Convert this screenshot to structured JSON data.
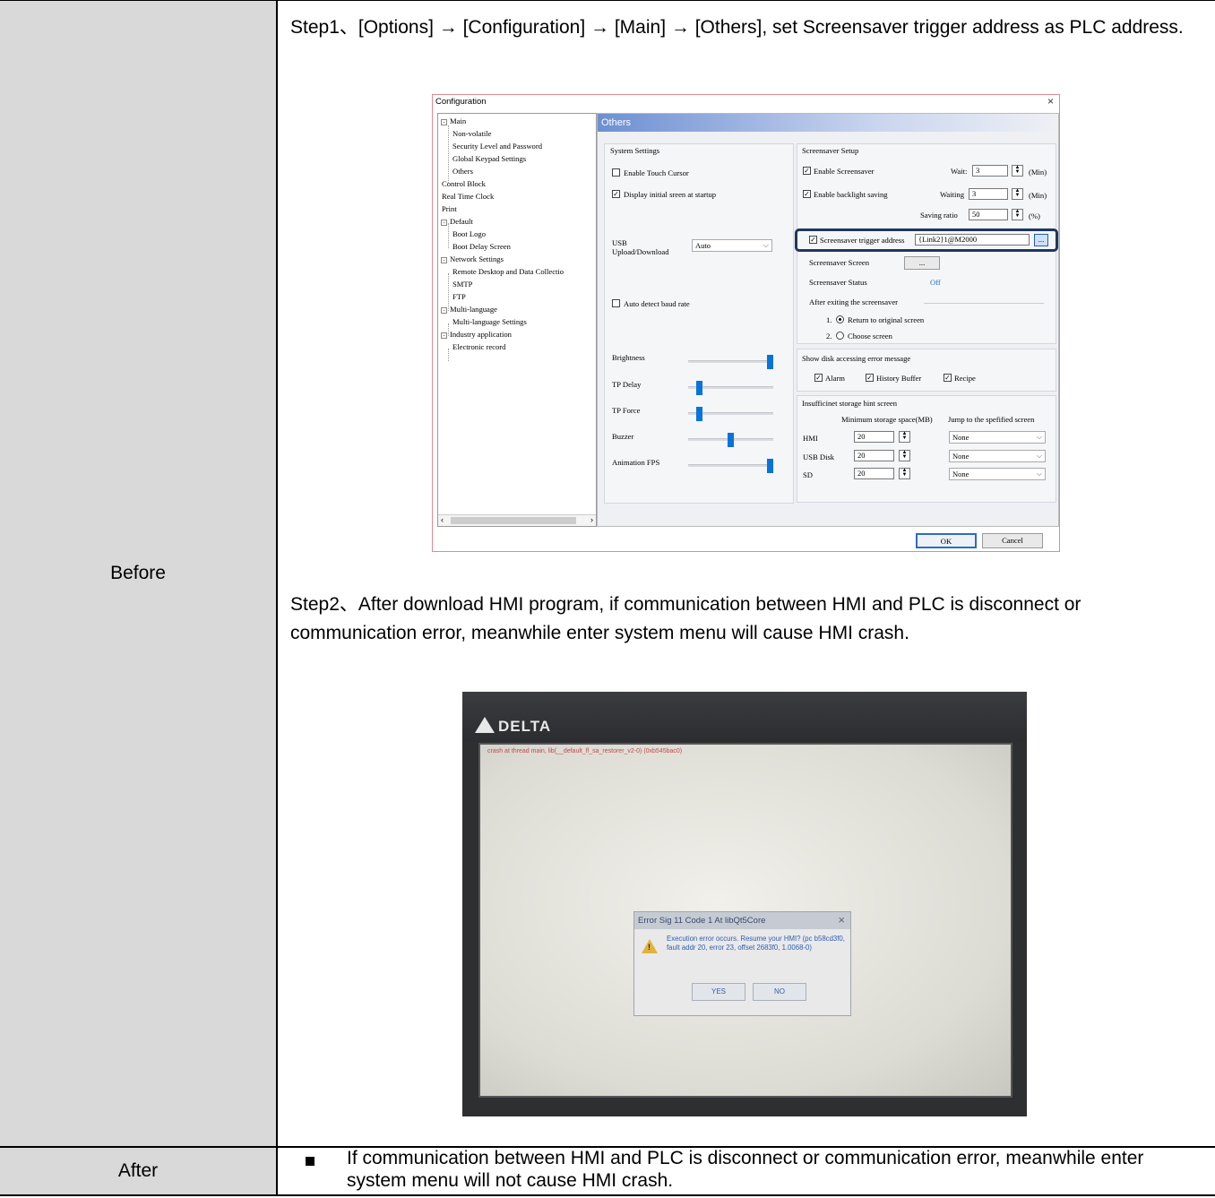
{
  "before": {
    "label": "Before",
    "step1": "Step1、[Options] → [Configuration] → [Main] → [Others], set Screensaver trigger address as PLC address.",
    "step2": "Step2、After download HMI program, if communication between HMI and PLC is disconnect or communication error, meanwhile enter system menu will cause HMI crash."
  },
  "after": {
    "label": "After",
    "text": "If communication between HMI and PLC is disconnect or communication error, meanwhile enter system menu will not cause HMI crash."
  },
  "dialog": {
    "title": "Configuration",
    "close": "×",
    "tree": [
      "Main",
      "Non-volatile",
      "Security Level and Password",
      "Global Keypad Settings",
      "Others",
      "Control Block",
      "Real Time Clock",
      "Print",
      "Default",
      "Boot Logo",
      "Boot Delay Screen",
      "Network Settings",
      "Remote Desktop and Data Collectio",
      "SMTP",
      "FTP",
      "Multi-language",
      "Multi-language Settings",
      "Industry application",
      "Electronic record"
    ],
    "panel_title": "Others",
    "system": {
      "title": "System Settings",
      "touch_cursor": "Enable Touch Cursor",
      "initial_screen": "Display initial sreen at startup",
      "usb_label_1": "USB",
      "usb_label_2": "Upload/Download",
      "usb_value": "Auto",
      "auto_baud": "Auto detect baud rate",
      "brightness": "Brightness",
      "tp_delay": "TP Delay",
      "tp_force": "TP Force",
      "buzzer": "Buzzer",
      "fps": "Animation FPS",
      "levels": {
        "brightness": 1.0,
        "tp_delay": 0.1,
        "tp_force": 0.1,
        "buzzer": 0.5,
        "fps": 1.0
      }
    },
    "screensaver": {
      "title": "Screensaver Setup",
      "enable": "Enable Screensaver",
      "wait_label": "Wait:",
      "wait_value": "3",
      "min1": "(Min)",
      "backlight": "Enable backlight saving",
      "waiting_label": "Waiting",
      "waiting_value": "3",
      "min2": "(Min)",
      "ratio_label": "Saving ratio",
      "ratio_value": "50",
      "pct": "(%)",
      "trigger": "Screensaver trigger address",
      "trigger_value": "{Link2}1@M2000",
      "browse": "...",
      "screen_label": "Screensaver Screen",
      "screen_btn": "...",
      "status_label": "Screensaver Status",
      "status_value": "Off",
      "exit_label": "After exiting the screensaver",
      "opt1": "1.",
      "opt1_text": "Return to original screen",
      "opt2": "2.",
      "opt2_text": "Choose screen"
    },
    "disk": {
      "title": "Show disk accessing error message",
      "alarm": "Alarm",
      "history": "History Buffer",
      "recipe": "Recipe"
    },
    "storage": {
      "title": "Insufficinet storage hint screen",
      "col1": "Minimum storage space(MB)",
      "col2": "Jump to the spefified screen",
      "rows": [
        {
          "name": "HMI",
          "value": "20",
          "screen": "None"
        },
        {
          "name": "USB Disk",
          "value": "20",
          "screen": "None"
        },
        {
          "name": "SD",
          "value": "20",
          "screen": "None"
        }
      ]
    },
    "ok": "OK",
    "cancel": "Cancel"
  },
  "photo": {
    "brand": "DELTA",
    "crash_line": "crash at thread main, lib(__default_fl_sa_restorer_v2-0) (0xb545bac0)",
    "error_title": "Error Sig 11 Code 1 At libQt5Core",
    "error_x": "×",
    "error_msg": "Execution error occurs. Resume your HMI? (pc b58cd3f0, fault addr 20, error 23, offset 2683f0, 1.0068-0)",
    "yes": "YES",
    "no": "NO"
  }
}
